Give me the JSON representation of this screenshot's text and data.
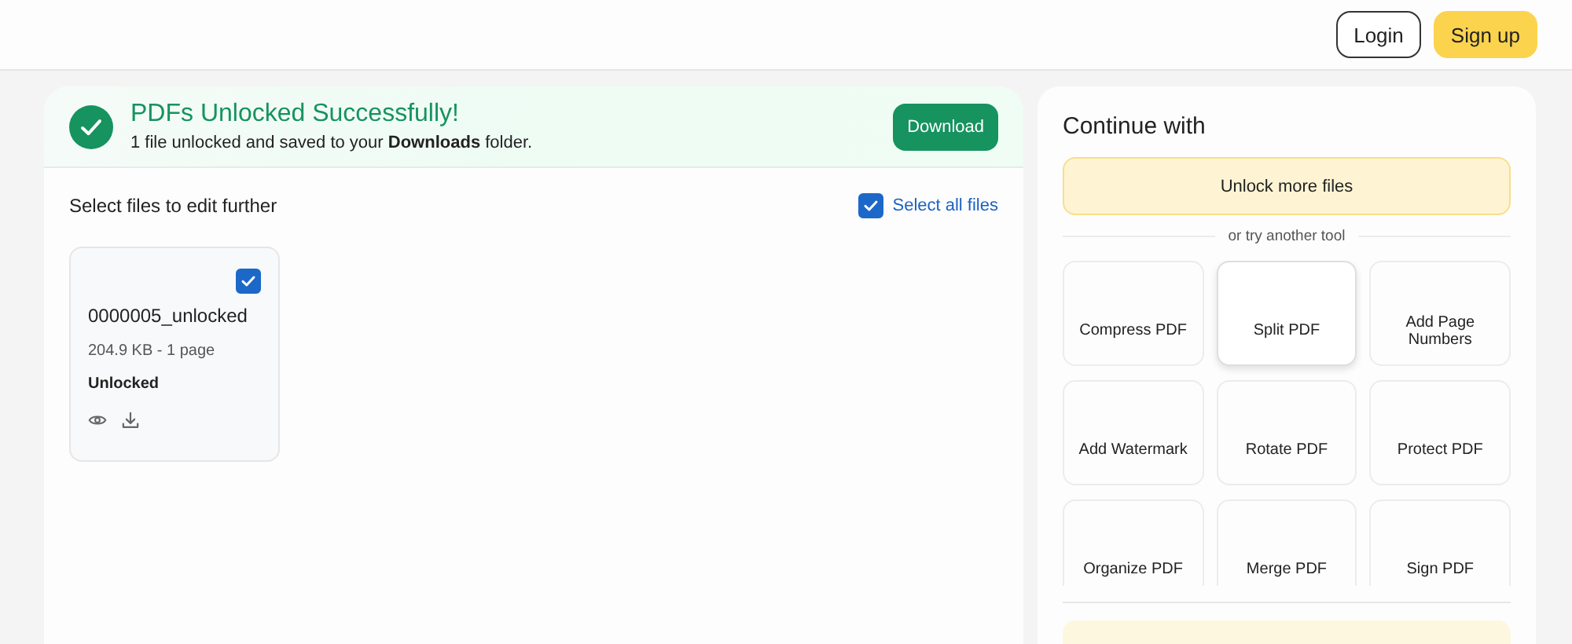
{
  "header": {
    "buttons": [
      {
        "label": "Login",
        "kind": "outline"
      },
      {
        "label": "Sign up",
        "kind": "primary"
      }
    ]
  },
  "banner": {
    "title": "PDFs Unlocked Successfully!",
    "message": "1 file unlocked and saved to your **Downloads** folder.",
    "button": "Download"
  },
  "files_section": {
    "heading": "Select files to edit further",
    "select_all": {
      "label": "Select all files",
      "checked": true
    },
    "files": [
      {
        "name": "0000005_unlocked",
        "meta": "204.9 KB - 1 page",
        "status": "Unlocked",
        "checked": true
      }
    ]
  },
  "continue_panel": {
    "title": "Continue with",
    "primary_button": "Unlock more files",
    "divider_text": "or try another tool",
    "tools": [
      {
        "label": "Compress PDF",
        "hovered": false
      },
      {
        "label": "Split PDF",
        "hovered": true
      },
      {
        "label": "Add Page Numbers",
        "hovered": false
      },
      {
        "label": "Add Watermark",
        "hovered": false
      },
      {
        "label": "Rotate PDF",
        "hovered": false
      },
      {
        "label": "Protect PDF",
        "hovered": false
      },
      {
        "label": "Organize PDF",
        "hovered": false
      },
      {
        "label": "Merge PDF",
        "hovered": false
      },
      {
        "label": "Sign PDF",
        "hovered": false
      }
    ]
  }
}
